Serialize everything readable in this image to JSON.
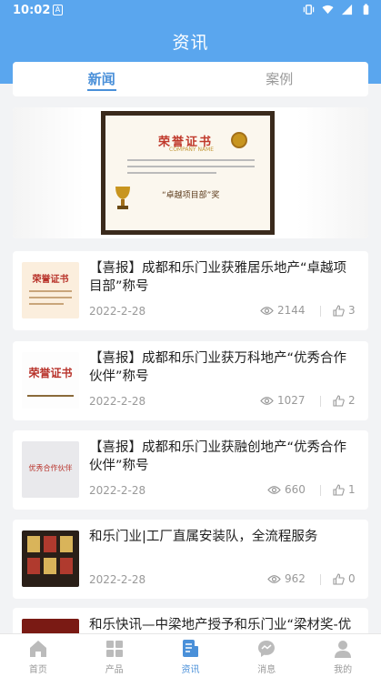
{
  "status": {
    "time": "10:02",
    "sim": "A"
  },
  "header": {
    "title": "资讯"
  },
  "tabs": [
    {
      "label": "新闻",
      "active": true
    },
    {
      "label": "案例",
      "active": false
    }
  ],
  "banner": {
    "cert_title": "荣誉证书",
    "cert_subtitle": "COMPANY NAME",
    "cert_award": "“卓越项目部”奖"
  },
  "news": [
    {
      "title": "【喜报】成都和乐门业获雅居乐地产“卓越项目部”称号",
      "date": "2022-2-28",
      "views": "2144",
      "likes": "3",
      "thumb_text": "荣誉证书"
    },
    {
      "title": "【喜报】成都和乐门业获万科地产“优秀合作伙伴”称号",
      "date": "2022-2-28",
      "views": "1027",
      "likes": "2",
      "thumb_text": "荣誉证书"
    },
    {
      "title": "【喜报】成都和乐门业获融创地产“优秀合作伙伴”称号",
      "date": "2022-2-28",
      "views": "660",
      "likes": "1",
      "thumb_text": "优秀合作伙伴"
    },
    {
      "title": "和乐门业|工厂直属安装队，全流程服务",
      "date": "2022-2-28",
      "views": "962",
      "likes": "0",
      "thumb_text": ""
    },
    {
      "title": "和乐快讯—中梁地产授予和乐门业“梁材奖-优秀集采”荣誉",
      "date": "",
      "views": "",
      "likes": "",
      "thumb_text": ""
    }
  ],
  "tabbar": [
    {
      "label": "首页",
      "icon": "home-icon",
      "active": false
    },
    {
      "label": "产品",
      "icon": "grid-icon",
      "active": false
    },
    {
      "label": "资讯",
      "icon": "news-icon",
      "active": true
    },
    {
      "label": "消息",
      "icon": "chat-icon",
      "active": false
    },
    {
      "label": "我的",
      "icon": "user-icon",
      "active": false
    }
  ],
  "colors": {
    "primary": "#5aa6ee",
    "active": "#4a90d9",
    "background": "#f2f3f5"
  }
}
